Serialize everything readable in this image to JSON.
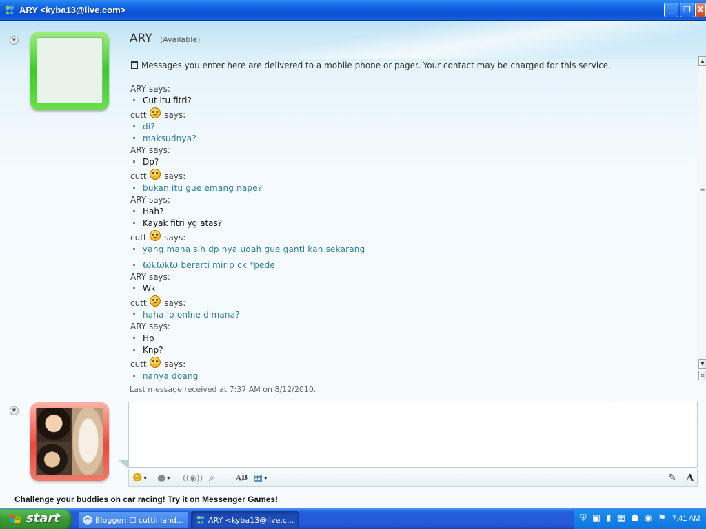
{
  "window": {
    "title": "ARY <kyba13@live.com>",
    "controls": {
      "minimize": "_",
      "maximize": "❐",
      "close": "X"
    }
  },
  "contact": {
    "name": "ARY",
    "status": "(Available)"
  },
  "notice": "Messages you enter here are delivered to a mobile phone or pager. Your contact may be charged for this service.",
  "conversation": [
    {
      "sender": "ARY",
      "who": "ary",
      "says": "says:",
      "lines": [
        "Cut itu fitri?"
      ]
    },
    {
      "sender": "cutt",
      "who": "cutt",
      "says": "says:",
      "lines": [
        "di?",
        "maksudnya?"
      ]
    },
    {
      "sender": "ARY",
      "who": "ary",
      "says": "says:",
      "lines": [
        "Dp?"
      ]
    },
    {
      "sender": "cutt",
      "who": "cutt",
      "says": "says:",
      "lines": [
        "bukan itu gue emang nape?"
      ]
    },
    {
      "sender": "ARY",
      "who": "ary",
      "says": "says:",
      "lines": [
        "Hah?",
        "Kayak fitri yg atas?"
      ]
    },
    {
      "sender": "cutt",
      "who": "cutt",
      "says": "says:",
      "lines": [
        "yang mana sih dp nya udah gue ganti kan sekarang"
      ]
    },
    {
      "sender": "",
      "who": "cutt-cont",
      "says": "",
      "lines": [],
      "wk": {
        "w1": "ω",
        "k1": "k",
        "w2": "ω",
        "k2": "k",
        "w3": "ω",
        "rest": " berarti mirip ck *pede"
      }
    },
    {
      "sender": "ARY",
      "who": "ary",
      "says": "says:",
      "lines": [
        "Wk"
      ]
    },
    {
      "sender": "cutt",
      "who": "cutt",
      "says": "says:",
      "lines": [
        "haha lo onlne dimana?"
      ]
    },
    {
      "sender": "ARY",
      "who": "ary",
      "says": "says:",
      "lines": [
        "Hp",
        "Knp?"
      ]
    },
    {
      "sender": "cutt",
      "who": "cutt",
      "says": "says:",
      "lines": [
        "nanya doang"
      ]
    }
  ],
  "last_message": "Last message received at 7:37 AM on 8/12/2010.",
  "promo": "Challenge your buddies on car racing! Try it on Messenger Games!",
  "toolbar": {
    "emoticon_icon": "smiley-icon",
    "wink_icon": "wink-icon",
    "nudge_icon": "nudge-icon",
    "voice_icon": "voice-clip-icon",
    "font_label": "A͟B",
    "background_icon": "background-icon",
    "handwriting_icon": "handwriting-icon",
    "text_mode_label": "A"
  },
  "taskbar": {
    "start_label": "start",
    "tasks": [
      {
        "label": "Blogger: ☐ cuttii land..."
      },
      {
        "label": "ARY <kyba13@live.c..."
      }
    ],
    "clock": "7:41 AM"
  },
  "colors": {
    "accent_blue": "#0a4fd2",
    "cutt_text": "#2d7ea0",
    "status_green": "#3ccc2a",
    "user_frame_red": "#e84a3a",
    "start_green": "#3a9a36"
  }
}
